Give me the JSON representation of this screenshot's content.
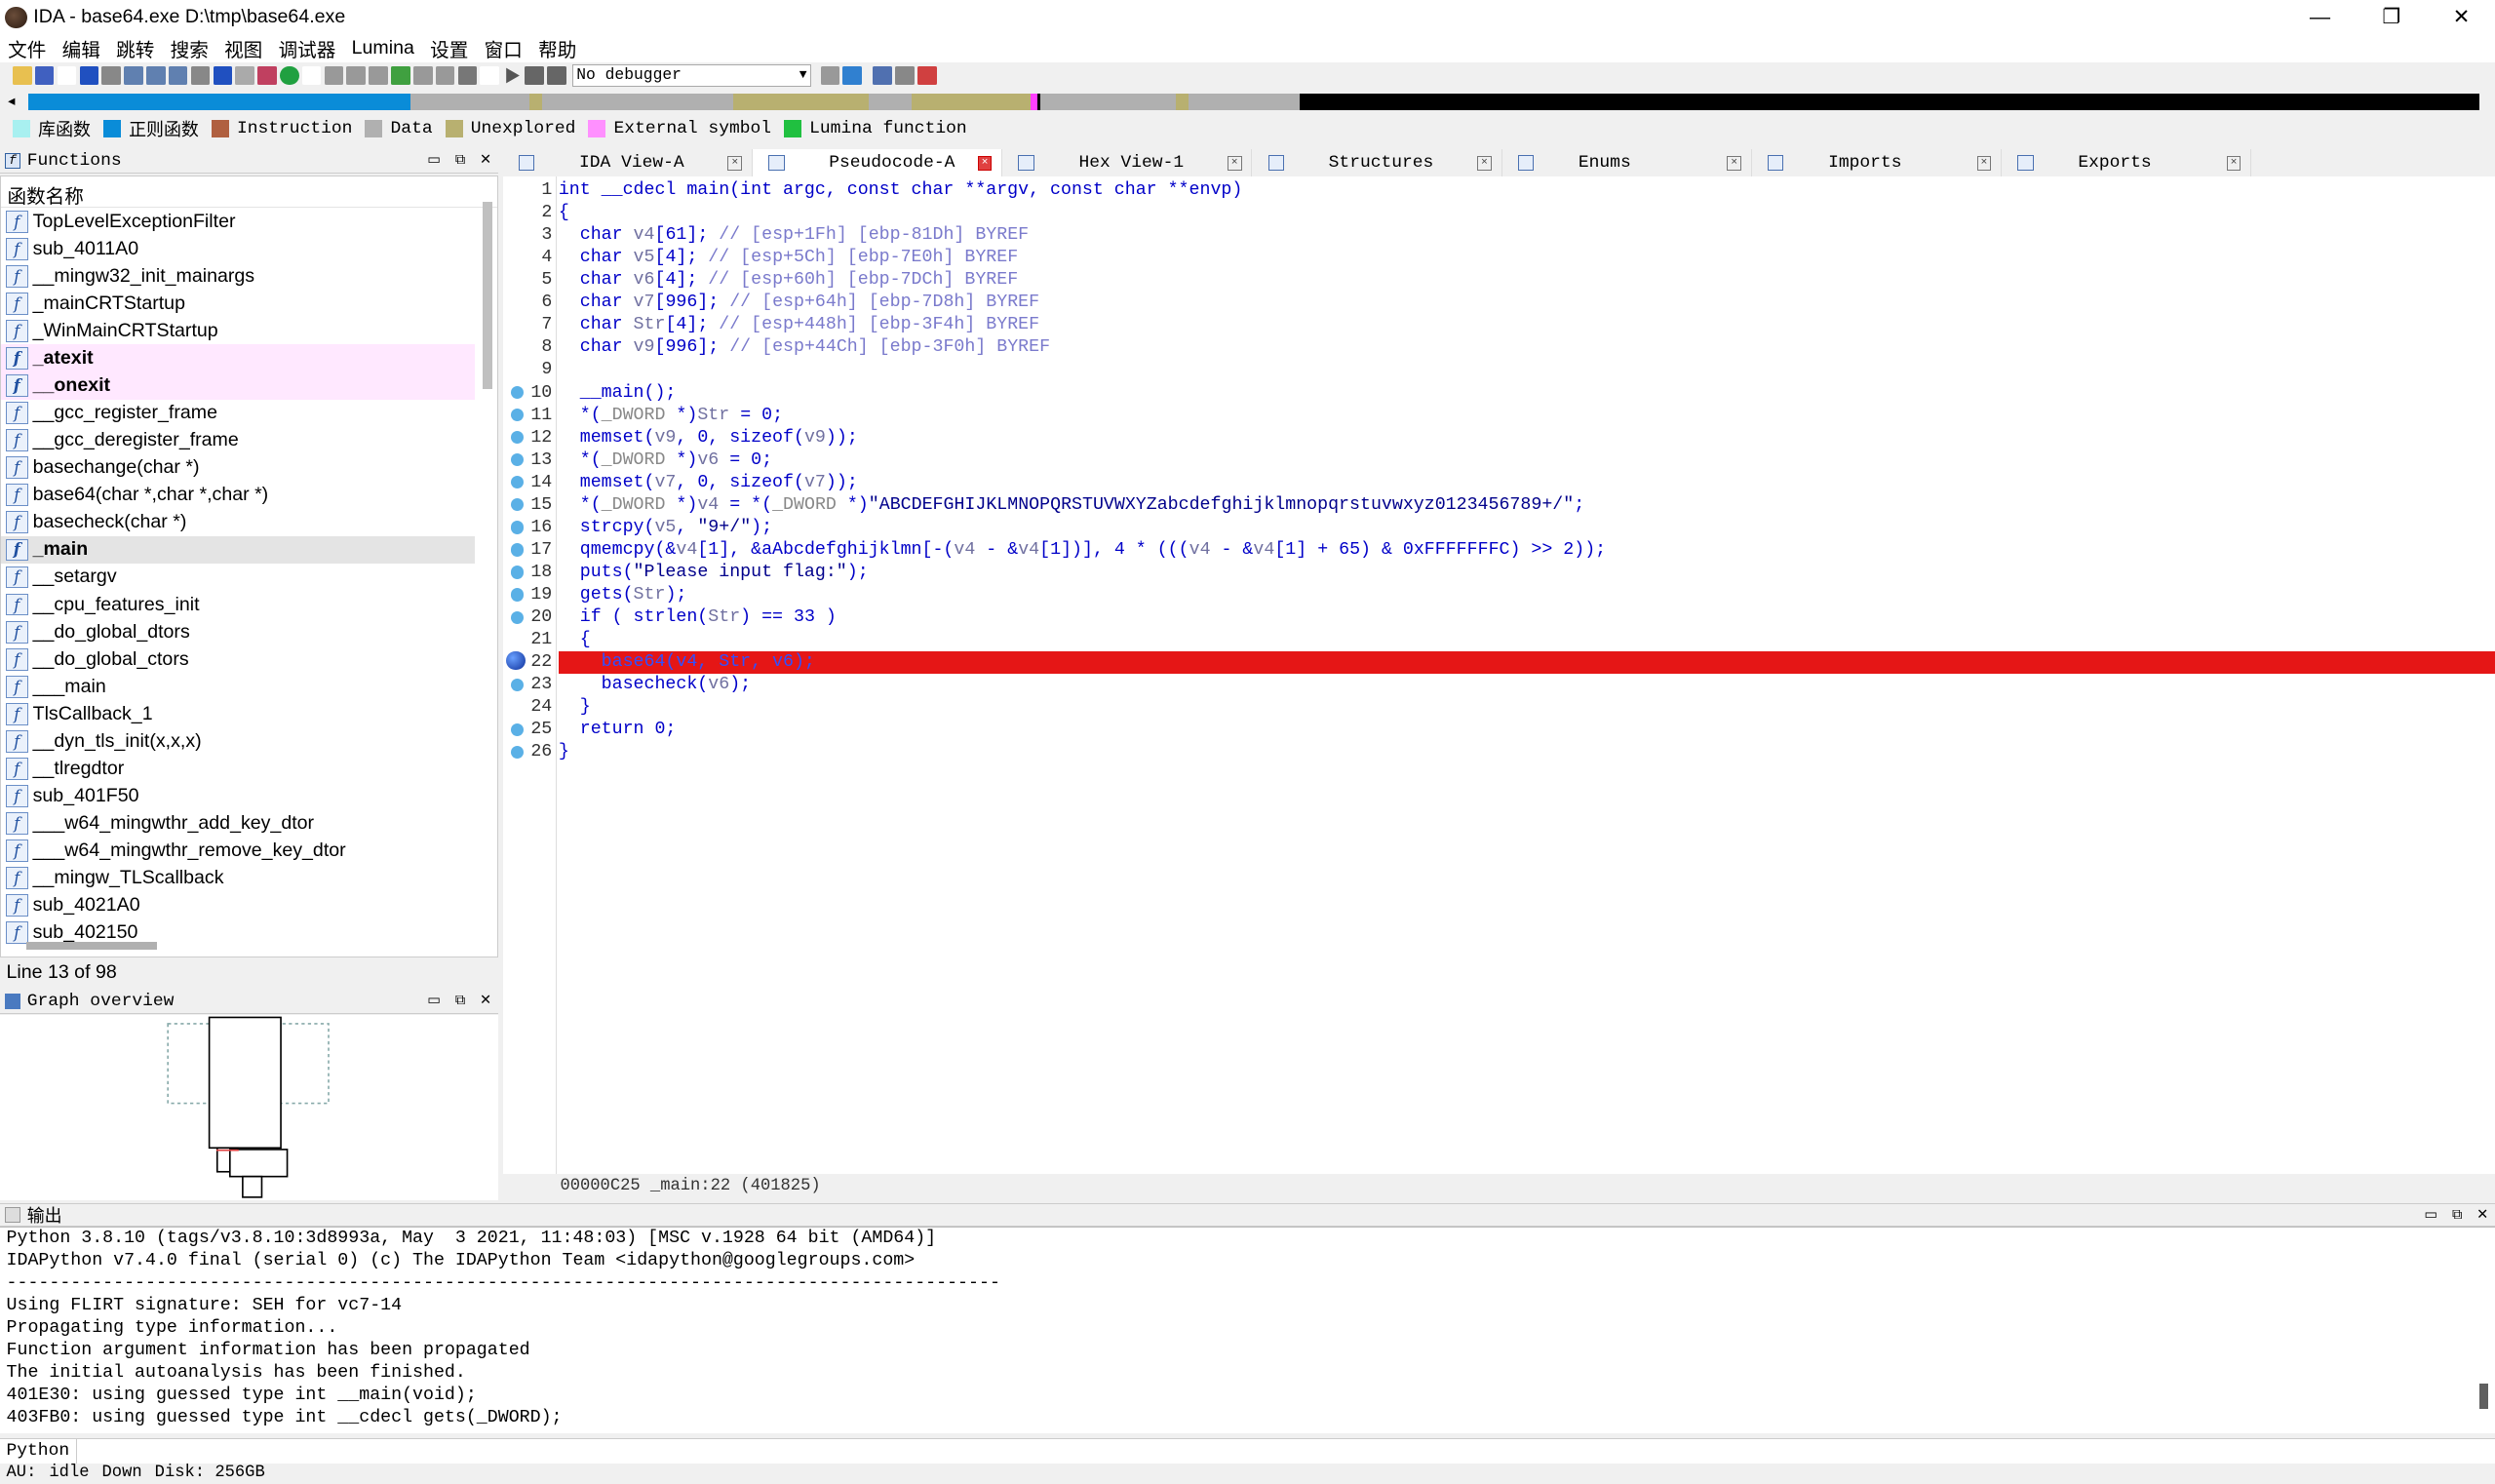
{
  "window": {
    "title": "IDA - base64.exe D:\\tmp\\base64.exe",
    "minimize": "—",
    "maximize": "❐",
    "close": "✕"
  },
  "menu": [
    "文件",
    "编辑",
    "跳转",
    "搜索",
    "视图",
    "调试器",
    "Lumina",
    "设置",
    "窗口",
    "帮助"
  ],
  "toolbar": {
    "debugger_select": "No debugger"
  },
  "legend": [
    {
      "label": "库函数",
      "color": "#a8f0f0"
    },
    {
      "label": "正则函数",
      "color": "#0a8cd8"
    },
    {
      "label": "Instruction",
      "color": "#b06040"
    },
    {
      "label": "Data",
      "color": "#b0b0b0"
    },
    {
      "label": "Unexplored",
      "color": "#b8b070"
    },
    {
      "label": "External symbol",
      "color": "#ff90ff"
    },
    {
      "label": "Lumina function",
      "color": "#20c040"
    }
  ],
  "functions_panel": {
    "title": "Functions",
    "column_header": "函数名称",
    "items": [
      "TopLevelExceptionFilter",
      "sub_4011A0",
      "__mingw32_init_mainargs",
      "_mainCRTStartup",
      "_WinMainCRTStartup",
      "_atexit",
      "__onexit",
      "__gcc_register_frame",
      "__gcc_deregister_frame",
      "basechange(char *)",
      "base64(char *,char *,char *)",
      "basecheck(char *)",
      "_main",
      "__setargv",
      "__cpu_features_init",
      "__do_global_dtors",
      "__do_global_ctors",
      "___main",
      "TlsCallback_1",
      "__dyn_tls_init(x,x,x)",
      "__tlregdtor",
      "sub_401F50",
      "___w64_mingwthr_add_key_dtor",
      "___w64_mingwthr_remove_key_dtor",
      "__mingw_TLScallback",
      "sub_4021A0",
      "sub_402150"
    ],
    "pink": [
      5,
      6
    ],
    "selected": 12,
    "status": "Line 13 of 98"
  },
  "graph_panel": {
    "title": "Graph overview"
  },
  "tabs": [
    {
      "label": "IDA View-A",
      "active": false
    },
    {
      "label": "Pseudocode-A",
      "active": true
    },
    {
      "label": "Hex View-1",
      "active": false
    },
    {
      "label": "Structures",
      "active": false
    },
    {
      "label": "Enums",
      "active": false
    },
    {
      "label": "Imports",
      "active": false
    },
    {
      "label": "Exports",
      "active": false
    }
  ],
  "code_lines": [
    {
      "n": "1",
      "dot": "",
      "t": "int __cdecl main(int argc, const char **argv, const char **envp)"
    },
    {
      "n": "2",
      "dot": "",
      "t": "{"
    },
    {
      "n": "3",
      "dot": "",
      "t": "  char v4[61]; // [esp+1Fh] [ebp-81Dh] BYREF"
    },
    {
      "n": "4",
      "dot": "",
      "t": "  char v5[4]; // [esp+5Ch] [ebp-7E0h] BYREF"
    },
    {
      "n": "5",
      "dot": "",
      "t": "  char v6[4]; // [esp+60h] [ebp-7DCh] BYREF"
    },
    {
      "n": "6",
      "dot": "",
      "t": "  char v7[996]; // [esp+64h] [ebp-7D8h] BYREF"
    },
    {
      "n": "7",
      "dot": "",
      "t": "  char Str[4]; // [esp+448h] [ebp-3F4h] BYREF"
    },
    {
      "n": "8",
      "dot": "",
      "t": "  char v9[996]; // [esp+44Ch] [ebp-3F0h] BYREF"
    },
    {
      "n": "9",
      "dot": "",
      "t": ""
    },
    {
      "n": "10",
      "dot": "s",
      "t": "  __main();"
    },
    {
      "n": "11",
      "dot": "s",
      "t": "  *(_DWORD *)Str = 0;"
    },
    {
      "n": "12",
      "dot": "s",
      "t": "  memset(v9, 0, sizeof(v9));"
    },
    {
      "n": "13",
      "dot": "s",
      "t": "  *(_DWORD *)v6 = 0;"
    },
    {
      "n": "14",
      "dot": "s",
      "t": "  memset(v7, 0, sizeof(v7));"
    },
    {
      "n": "15",
      "dot": "s",
      "t": "  *(_DWORD *)v4 = *(_DWORD *)\"ABCDEFGHIJKLMNOPQRSTUVWXYZabcdefghijklmnopqrstuvwxyz0123456789+/\";"
    },
    {
      "n": "16",
      "dot": "s",
      "t": "  strcpy(v5, \"9+/\");"
    },
    {
      "n": "17",
      "dot": "s",
      "t": "  qmemcpy(&v4[1], &aAbcdefghijklmn[-(v4 - &v4[1])], 4 * (((v4 - &v4[1] + 65) & 0xFFFFFFFC) >> 2));"
    },
    {
      "n": "18",
      "dot": "s",
      "t": "  puts(\"Please input flag:\");"
    },
    {
      "n": "19",
      "dot": "s",
      "t": "  gets(Str);"
    },
    {
      "n": "20",
      "dot": "s",
      "t": "  if ( strlen(Str) == 33 )"
    },
    {
      "n": "21",
      "dot": "",
      "t": "  {"
    },
    {
      "n": "22",
      "dot": "b",
      "t": "    base64(v4, Str, v6);"
    },
    {
      "n": "23",
      "dot": "s",
      "t": "    basecheck(v6);"
    },
    {
      "n": "24",
      "dot": "",
      "t": "  }"
    },
    {
      "n": "25",
      "dot": "s",
      "t": "  return 0;"
    },
    {
      "n": "26",
      "dot": "s",
      "t": "}"
    }
  ],
  "highlight_line": 22,
  "address_bar": "00000C25 _main:22 (401825)",
  "output_panel": {
    "title": "输出",
    "lines": [
      "Python 3.8.10 (tags/v3.8.10:3d8993a, May  3 2021, 11:48:03) [MSC v.1928 64 bit (AMD64)]",
      "IDAPython v7.4.0 final (serial 0) (c) The IDAPython Team <idapython@googlegroups.com>",
      "---------------------------------------------------------------------------------------------",
      "Using FLIRT signature: SEH for vc7-14",
      "Propagating type information...",
      "Function argument information has been propagated",
      "The initial autoanalysis has been finished.",
      "401E30: using guessed type int __main(void);",
      "403FB0: using guessed type int __cdecl gets(_DWORD);"
    ]
  },
  "python_tab": "Python",
  "status": {
    "au": "AU:",
    "state": "idle",
    "dir": "Down",
    "disk": "Disk: 256GB"
  }
}
